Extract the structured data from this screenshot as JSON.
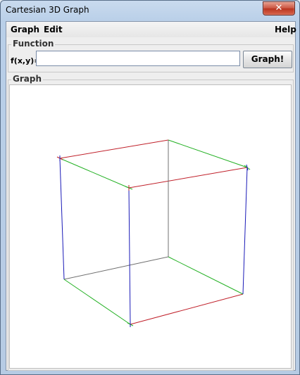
{
  "window": {
    "title": "Cartesian 3D Graph",
    "close_label": "✕"
  },
  "menubar": {
    "items": [
      "Graph",
      "Edit"
    ],
    "help": "Help"
  },
  "function_panel": {
    "legend": "Function",
    "label": "f(x,y)=",
    "input_value": "",
    "button_label": "Graph!"
  },
  "graph_panel": {
    "legend": "Graph"
  },
  "colors": {
    "x_axis": "#c0202a",
    "y_axis": "#1a1ab8",
    "z_axis": "#22b022",
    "back_edges": "#707070"
  }
}
